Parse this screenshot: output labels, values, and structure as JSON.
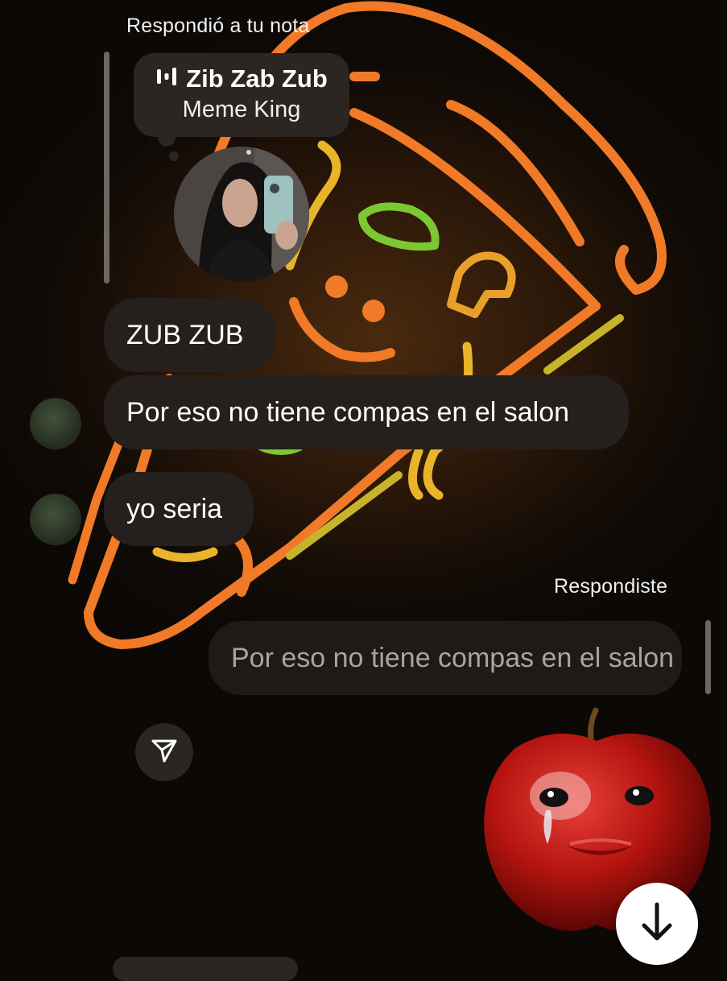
{
  "note_reply": {
    "header": "Respondió a tu nota",
    "note_title": "Zib Zab Zub",
    "note_subtitle": "Meme King"
  },
  "messages": [
    {
      "text": "ZUB ZUB"
    },
    {
      "text": "Por eso no tiene compas en el salon"
    },
    {
      "text": "yo seria"
    }
  ],
  "my_reply": {
    "header": "Respondiste",
    "quoted_text": "Por eso no tiene compas en el salon"
  },
  "icons": {
    "music": "music-bars-icon",
    "send": "send-paper-plane-icon",
    "scroll_down": "arrow-down-icon"
  },
  "colors": {
    "bubble": "#25201d",
    "neon_orange": "#f07a28",
    "neon_yellow": "#e8b42a",
    "neon_green": "#7cc832"
  }
}
